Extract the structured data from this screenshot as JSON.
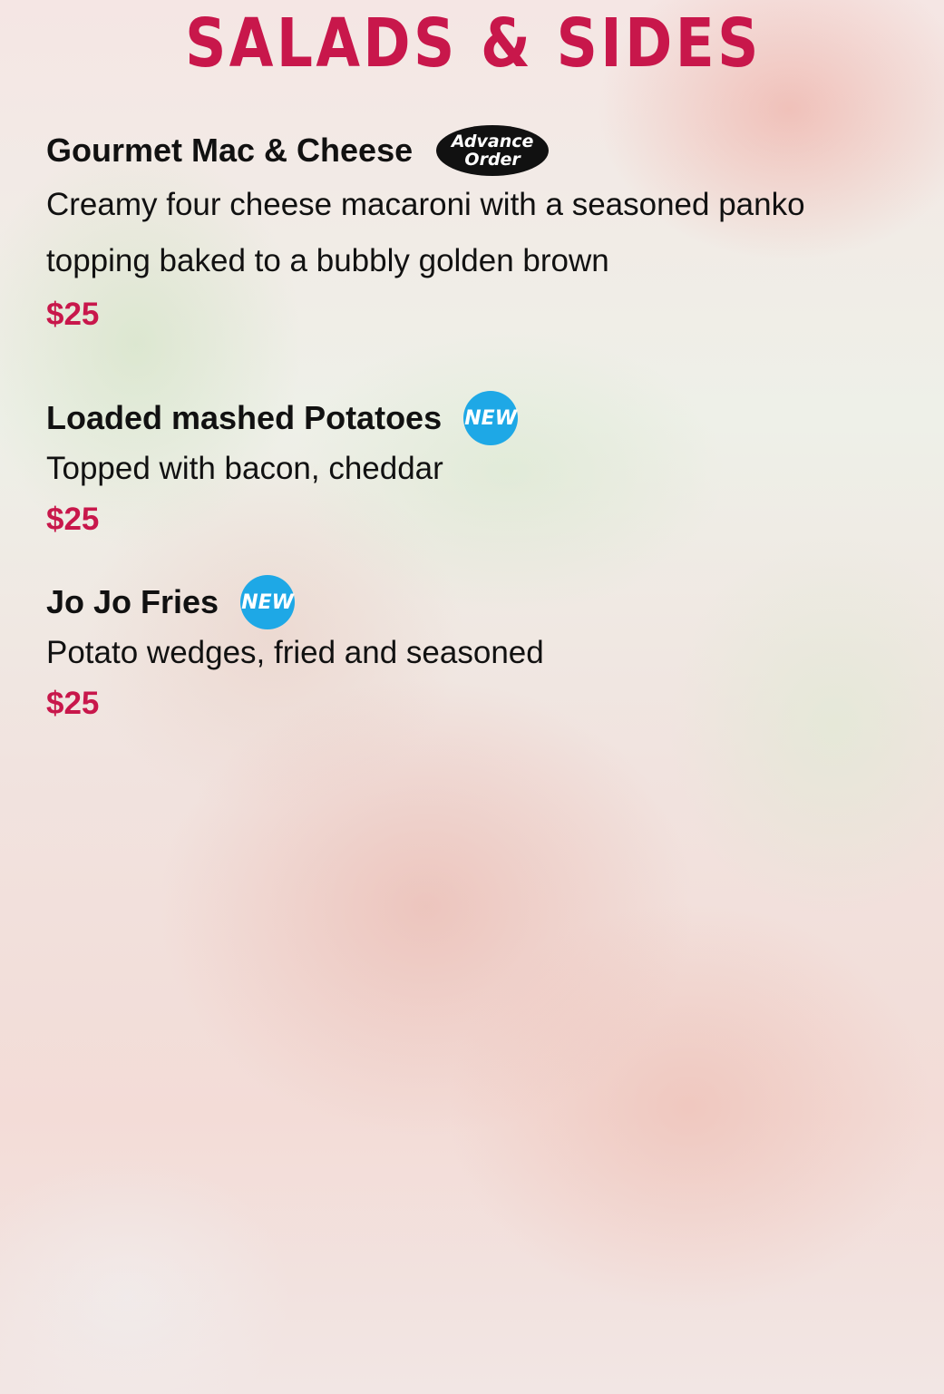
{
  "page": {
    "title": "SALADS & SIDES"
  },
  "colors": {
    "title": "#c8174b",
    "price": "#c8174b",
    "new_badge": "#1ea8e6",
    "advance_badge": "#111111"
  },
  "items": [
    {
      "name": "Gourmet Mac & Cheese",
      "badge": {
        "type": "advance-order",
        "line1": "Advance",
        "line2": "Order"
      },
      "description": [
        "Creamy four cheese macaroni with a seasoned panko",
        "topping baked to a bubbly golden brown"
      ],
      "price": "$25"
    },
    {
      "name": "Loaded mashed Potatoes",
      "badge": {
        "type": "new",
        "label": "NEW"
      },
      "description": [
        "Topped with bacon, cheddar"
      ],
      "price": "$25"
    },
    {
      "name": "Jo Jo Fries",
      "badge": {
        "type": "new",
        "label": "NEW"
      },
      "description": [
        "Potato wedges, fried and seasoned"
      ],
      "price": "$25"
    }
  ]
}
